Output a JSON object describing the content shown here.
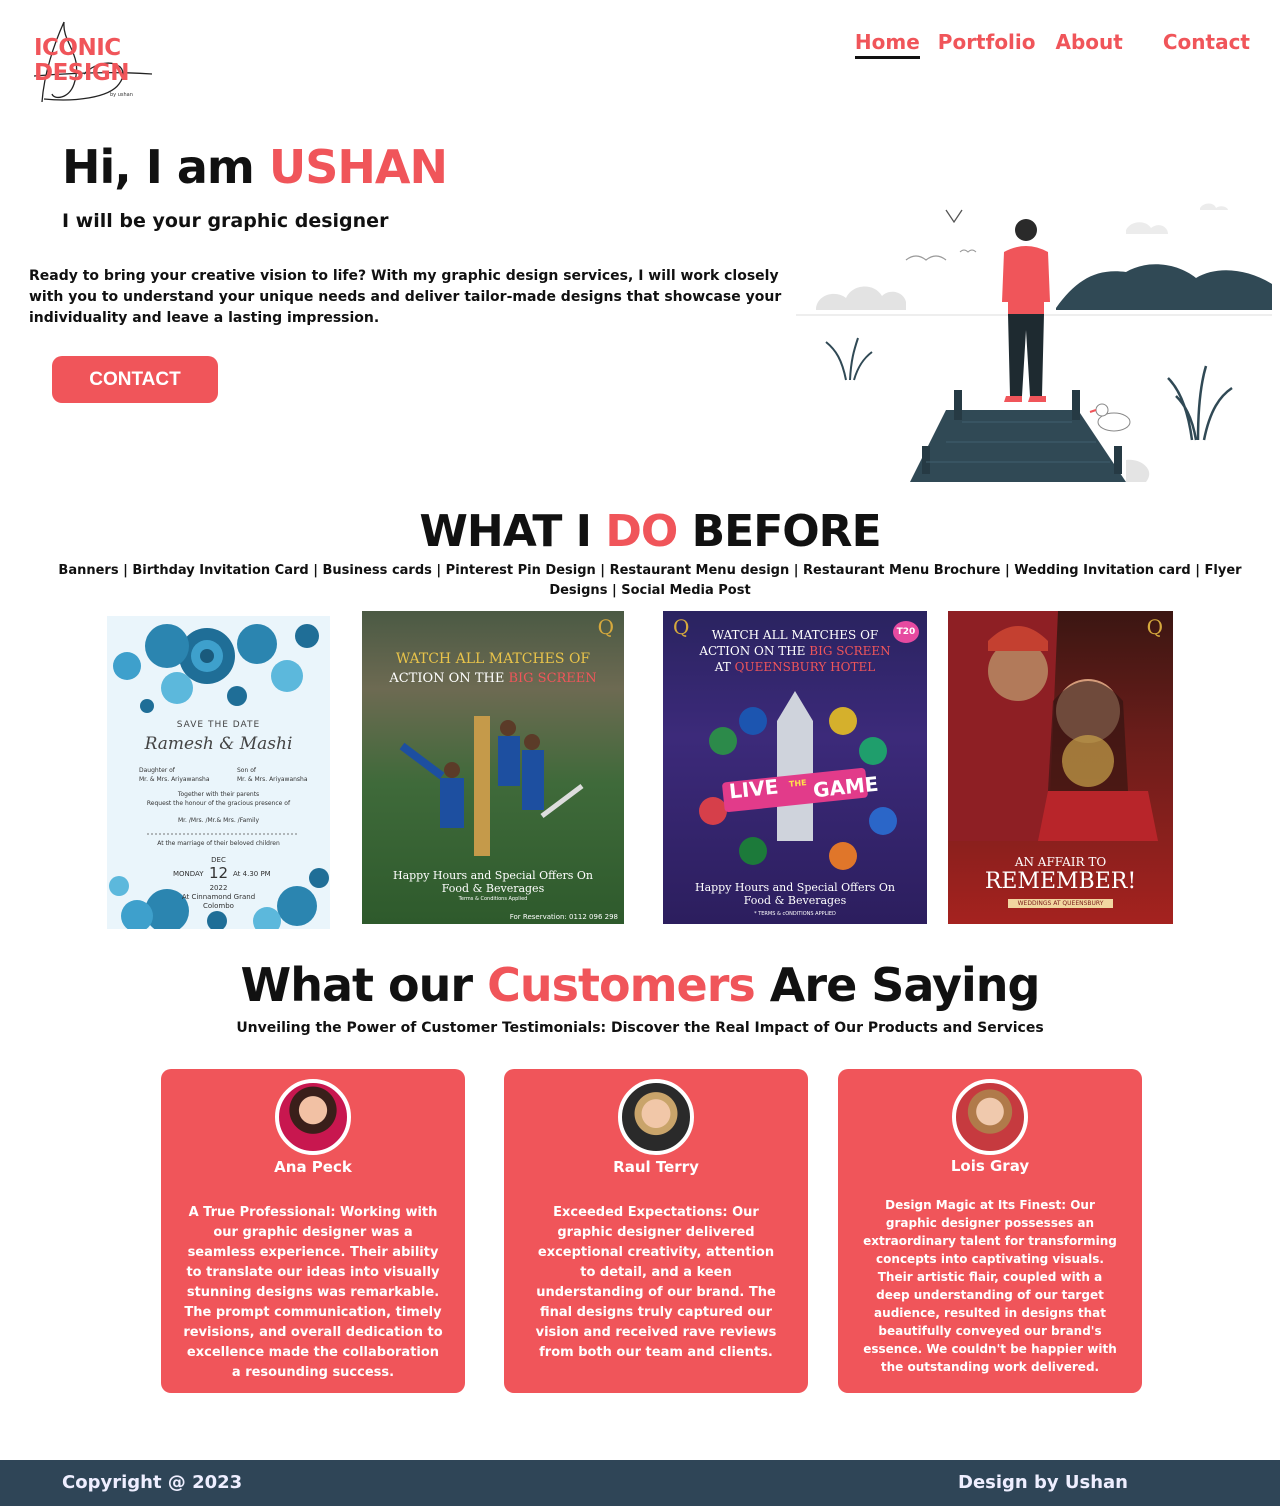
{
  "header": {
    "logo": {
      "line1": "ICONIC",
      "line2": "DESIGN",
      "tagline": "by ushan"
    },
    "nav": [
      {
        "label": "Home",
        "active": true
      },
      {
        "label": "Portfolio",
        "active": false
      },
      {
        "label": "About",
        "active": false
      },
      {
        "label": "Contact",
        "active": false
      }
    ]
  },
  "hero": {
    "greeting": "Hi, I am ",
    "name": "USHAN",
    "subtitle": "I will be your graphic designer",
    "text": "Ready to bring your creative vision to life? With my graphic design services, I will work closely with you to understand your unique needs and deliver tailor-made designs that showcase your individuality and leave a lasting impression.",
    "cta_label": "CONTACT"
  },
  "work": {
    "title_before": "WHAT I ",
    "title_accent": "DO",
    "title_after": " BEFORE",
    "categories": "Banners | Birthday Invitation Card | Business cards | Pinterest Pin Design | Restaurant Menu design | Restaurant Menu Brochure | Wedding Invitation card | Flyer Designs | Social Media Post",
    "cards": [
      {
        "type": "invitation",
        "heading": "SAVE THE DATE",
        "names": "Ramesh & Mashi",
        "left_label": "Daughter of",
        "left_parents": "Mr. & Mrs. Ariyawansha",
        "right_label": "Son of",
        "right_parents": "Mr. & Mrs. Ariyawansha",
        "line1": "Together with their parents",
        "line2": "Request the honour of the gracious presence of",
        "line3": "Mr. /Mrs. /Mr.& Mrs. /Family",
        "line4": "At the marriage of their beloved children",
        "day": "MONDAY",
        "month": "DEC",
        "date": "12",
        "time": "At 4.30 PM",
        "year": "2022",
        "venue": "At Cinnamond Grand",
        "city": "Colombo"
      },
      {
        "type": "flyer1",
        "logo": "Q",
        "headline1": "WATCH ALL MATCHES OF",
        "headline2a": "ACTION ON THE ",
        "headline2b": "BIG SCREEN",
        "offer1": "Happy Hours and Special Offers On",
        "offer2": "Food & Beverages",
        "terms": "Terms & Conditions Applied",
        "reservation": "For Reservation: 0112 096 298"
      },
      {
        "type": "flyer2",
        "logo": "Q",
        "badge": "T20",
        "headline1": "WATCH ALL MATCHES OF",
        "headline2a": "ACTION ON THE ",
        "headline2b": "BIG SCREEN",
        "headline3a": "AT ",
        "headline3b": "QUEENSBURY HOTEL",
        "live1": "LIVE",
        "live2": "THE",
        "live3": "GAME",
        "offer1": "Happy Hours and Special Offers On",
        "offer2": "Food & Beverages",
        "terms": "* TERMS & cONDITIONS APPLIED"
      },
      {
        "type": "wedding",
        "logo": "Q",
        "line1": "AN AFFAIR TO",
        "line2": "REMEMBER!",
        "line3": "WEDDINGS AT QUEENSBURY"
      }
    ]
  },
  "testimonials": {
    "title_before": "What our ",
    "title_accent": "Customers",
    "title_after": " Are Saying",
    "subtitle": "Unveiling the Power of Customer Testimonials: Discover the Real Impact of Our Products and Services",
    "items": [
      {
        "name": "Ana Peck",
        "quote": "A True Professional: Working with our graphic designer was a seamless experience. Their ability to translate our ideas into visually stunning designs was remarkable. The prompt communication, timely revisions, and overall dedication to excellence made the collaboration a resounding success."
      },
      {
        "name": "Raul Terry",
        "quote": "Exceeded Expectations: Our graphic designer delivered exceptional creativity, attention to detail, and a keen understanding of our brand. The final designs truly captured our vision and received rave reviews from both our team and clients."
      },
      {
        "name": "Lois Gray",
        "quote": "Design Magic at Its Finest: Our graphic designer possesses an extraordinary talent for transforming concepts into captivating visuals. Their artistic flair, coupled with a deep understanding of our target audience, resulted in designs that beautifully conveyed our brand's essence. We couldn't be happier with the outstanding work delivered."
      }
    ]
  },
  "footer": {
    "copyright": "Copyright @ 2023",
    "credit": "Design by Ushan"
  }
}
